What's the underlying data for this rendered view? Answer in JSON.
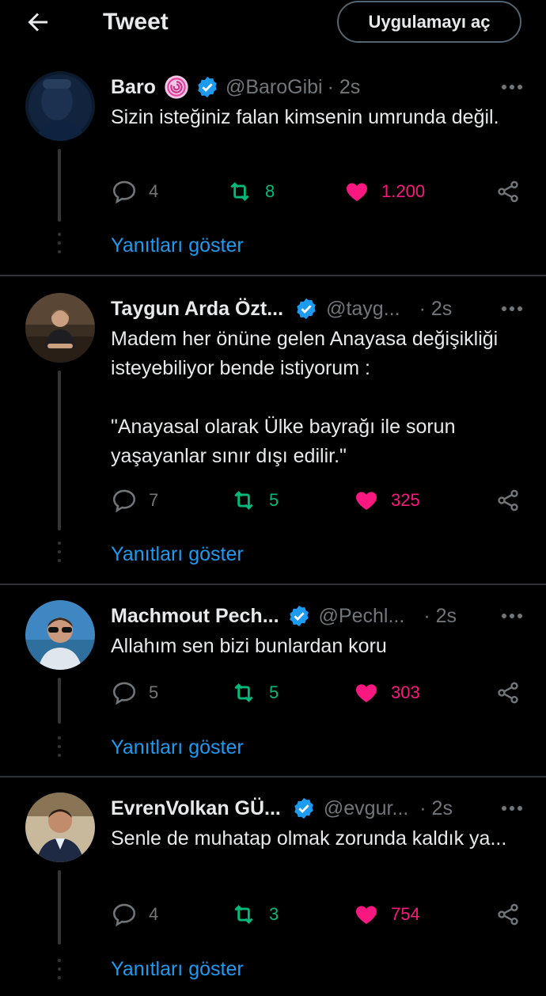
{
  "header": {
    "title": "Tweet",
    "open_app_label": "Uygulamayı aç"
  },
  "colors": {
    "accent": "#1d9bf0",
    "retweet": "#00ba7c",
    "like": "#f91880",
    "muted": "#71767b"
  },
  "replies": [
    {
      "name": "Baro",
      "handle": "@BaroGibi",
      "time": "· 2s",
      "text": "Sizin isteğiniz falan kimsenin umrunda değil.",
      "replies": "4",
      "retweets": "8",
      "likes": "1.200",
      "show_replies": "Yanıtları göster"
    },
    {
      "name": "Taygun Arda Özt...",
      "handle": "@tayg...",
      "time": "· 2s",
      "text": "Madem her önüne gelen Anayasa değişikliği isteyebiliyor bende istiyorum :\n\n\"Anayasal olarak Ülke bayrağı ile sorun yaşayanlar sınır dışı edilir.\"",
      "replies": "7",
      "retweets": "5",
      "likes": "325",
      "show_replies": "Yanıtları göster"
    },
    {
      "name": "Machmout Pech...",
      "handle": "@Pechl...",
      "time": "· 2s",
      "text": "Allahım sen bizi bunlardan koru",
      "replies": "5",
      "retweets": "5",
      "likes": "303",
      "show_replies": "Yanıtları göster"
    },
    {
      "name": "EvrenVolkan GÜ...",
      "handle": "@evgur...",
      "time": "· 2s",
      "text": "Senle de muhatap olmak zorunda kaldık ya...",
      "replies": "4",
      "retweets": "3",
      "likes": "754",
      "show_replies": "Yanıtları göster"
    }
  ]
}
